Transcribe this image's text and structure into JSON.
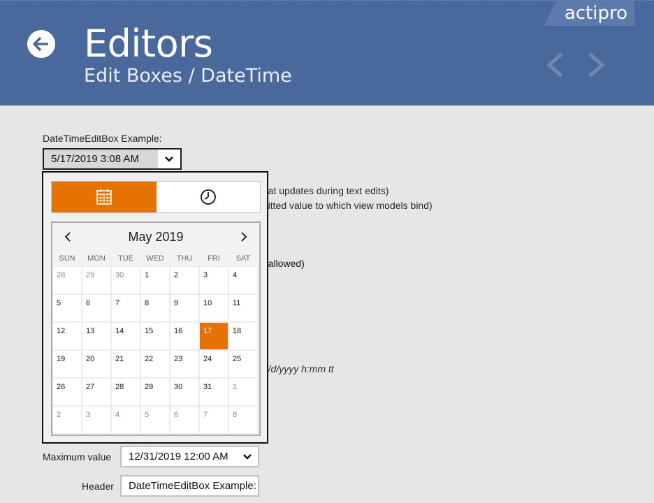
{
  "header": {
    "title": "Editors",
    "subtitle": "Edit Boxes / DateTime",
    "brand": "actipro",
    "colors": {
      "background": "#49689c",
      "accent": "#e67300"
    }
  },
  "example": {
    "label": "DateTimeEditBox Example:",
    "value": "5/17/2019 3:08 AM"
  },
  "background_text": {
    "line1": "that updates during text edits)",
    "line2": "mitted value to which view models bind)",
    "line3": "e allowed)",
    "line4": "M/d/yyyy h:mm tt"
  },
  "popup": {
    "date_mode_icon": "calendar-icon",
    "time_mode_icon": "clock-icon",
    "calendar": {
      "month_label": "May 2019",
      "weekdays": [
        "SUN",
        "MON",
        "TUE",
        "WED",
        "THU",
        "FRI",
        "SAT"
      ],
      "days": [
        {
          "d": "28",
          "other": true
        },
        {
          "d": "29",
          "other": true
        },
        {
          "d": "30",
          "other": true
        },
        {
          "d": "1"
        },
        {
          "d": "2"
        },
        {
          "d": "3"
        },
        {
          "d": "4"
        },
        {
          "d": "5"
        },
        {
          "d": "6"
        },
        {
          "d": "7"
        },
        {
          "d": "8"
        },
        {
          "d": "9"
        },
        {
          "d": "10"
        },
        {
          "d": "11"
        },
        {
          "d": "12"
        },
        {
          "d": "13"
        },
        {
          "d": "14"
        },
        {
          "d": "15"
        },
        {
          "d": "16"
        },
        {
          "d": "17",
          "selected": true
        },
        {
          "d": "18"
        },
        {
          "d": "19"
        },
        {
          "d": "20"
        },
        {
          "d": "21"
        },
        {
          "d": "22"
        },
        {
          "d": "23"
        },
        {
          "d": "24"
        },
        {
          "d": "25"
        },
        {
          "d": "26"
        },
        {
          "d": "27"
        },
        {
          "d": "28"
        },
        {
          "d": "29"
        },
        {
          "d": "30"
        },
        {
          "d": "31"
        },
        {
          "d": "1",
          "other": true
        },
        {
          "d": "2",
          "other": true
        },
        {
          "d": "3",
          "other": true
        },
        {
          "d": "4",
          "other": true
        },
        {
          "d": "5",
          "other": true
        },
        {
          "d": "6",
          "other": true
        },
        {
          "d": "7",
          "other": true
        },
        {
          "d": "8",
          "other": true
        }
      ]
    }
  },
  "form": {
    "max_label": "Maximum value",
    "max_value": "12/31/2019 12:00 AM",
    "header_label": "Header",
    "header_value": "DateTimeEditBox Example:"
  }
}
